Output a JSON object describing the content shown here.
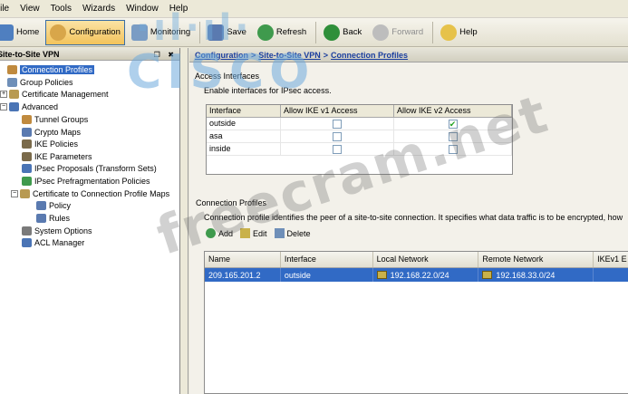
{
  "menu": [
    "File",
    "View",
    "Tools",
    "Wizards",
    "Window",
    "Help"
  ],
  "toolbar": {
    "home": "Home",
    "configuration": "Configuration",
    "monitoring": "Monitoring",
    "save": "Save",
    "refresh": "Refresh",
    "back": "Back",
    "forward": "Forward",
    "help": "Help"
  },
  "sidebar": {
    "title": "Site-to-Site VPN",
    "pin1": "❐",
    "pin2": "✖",
    "items": [
      {
        "label": "Connection Profiles"
      },
      {
        "label": "Group Policies"
      },
      {
        "label": "Certificate Management"
      },
      {
        "label": "Advanced"
      },
      {
        "label": "Tunnel Groups"
      },
      {
        "label": "Crypto Maps"
      },
      {
        "label": "IKE Policies"
      },
      {
        "label": "IKE Parameters"
      },
      {
        "label": "IPsec Proposals (Transform Sets)"
      },
      {
        "label": "IPsec Prefragmentation Policies"
      },
      {
        "label": "Certificate to Connection Profile Maps"
      },
      {
        "label": "Policy"
      },
      {
        "label": "Rules"
      },
      {
        "label": "System Options"
      },
      {
        "label": "ACL Manager"
      }
    ]
  },
  "breadcrumb": {
    "part1": "Configuration",
    "part2": "Site-to-Site VPN",
    "part3": "Connection Profiles",
    "separator": ">"
  },
  "access_interfaces": {
    "title": "Access Interfaces",
    "description": "Enable interfaces for IPsec access.",
    "columns": [
      "Interface",
      "Allow IKE v1 Access",
      "Allow IKE v2 Access"
    ],
    "rows": [
      {
        "interface": "outside",
        "ikev1": false,
        "ikev2": true
      },
      {
        "interface": "asa",
        "ikev1": false,
        "ikev2": false
      },
      {
        "interface": "inside",
        "ikev1": false,
        "ikev2": false
      }
    ],
    "check_mark": "✔"
  },
  "connection_profiles": {
    "title": "Connection Profiles",
    "description": "Connection profile identifies the peer of a site-to-site connection. It specifies what data traffic is to be encrypted, how",
    "add": "Add",
    "edit": "Edit",
    "delete": "Delete",
    "columns": [
      "Name",
      "Interface",
      "Local Network",
      "Remote Network",
      "IKEv1 E"
    ],
    "rows": [
      {
        "name": "209.165.201.2",
        "interface": "outside",
        "local": "192.168.22.0/24",
        "remote": "192.168.33.0/24",
        "ikev1": ""
      }
    ]
  },
  "watermarks": {
    "cisco_dots": "·ıl·ıl·",
    "cisco": "CISCO",
    "site": "freecram.net"
  }
}
